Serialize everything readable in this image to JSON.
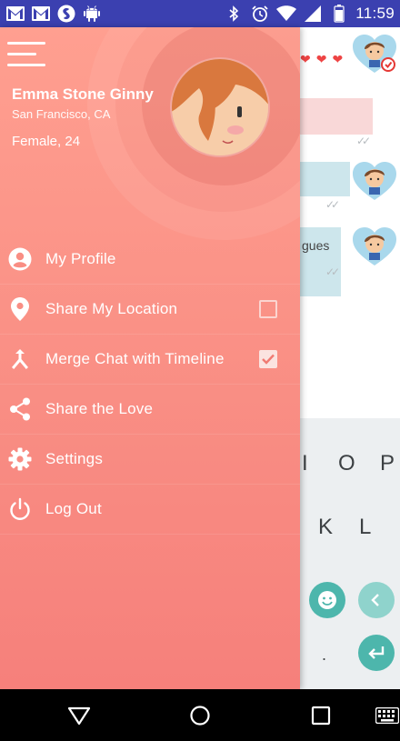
{
  "status_bar": {
    "left_icons": [
      "gmail-icon",
      "gmail-icon",
      "shazam-icon",
      "android-icon"
    ],
    "right_icons": [
      "bluetooth-icon",
      "alarm-icon",
      "wifi-icon",
      "signal-icon",
      "battery-icon"
    ],
    "time": "11:59"
  },
  "drawer": {
    "user": {
      "name": "Emma Stone Ginny",
      "location": "San Francisco, CA",
      "details": "Female, 24"
    },
    "menu": [
      {
        "label": "My Profile",
        "icon": "person-icon"
      },
      {
        "label": "Share My Location",
        "icon": "location-pin-icon",
        "checkbox": false
      },
      {
        "label": "Merge Chat with Timeline",
        "icon": "merge-icon",
        "checkbox": true
      },
      {
        "label": "Share the Love",
        "icon": "share-icon"
      },
      {
        "label": "Settings",
        "icon": "gear-icon"
      },
      {
        "label": "Log Out",
        "icon": "power-icon"
      }
    ]
  },
  "chat": {
    "partial_text": "gues"
  },
  "keyboard": {
    "row1": [
      "I",
      "O",
      "P"
    ],
    "row2": [
      "K",
      "L"
    ],
    "period": "."
  },
  "nav_bar": [
    "back-icon",
    "home-icon",
    "recents-icon",
    "keyboard-icon"
  ],
  "colors": {
    "status_bar": "#3b40b0",
    "drawer_top": "#ff9f90",
    "drawer_bottom": "#f6807b",
    "accent_teal": "#4db6ac",
    "heart_red": "#e44"
  }
}
